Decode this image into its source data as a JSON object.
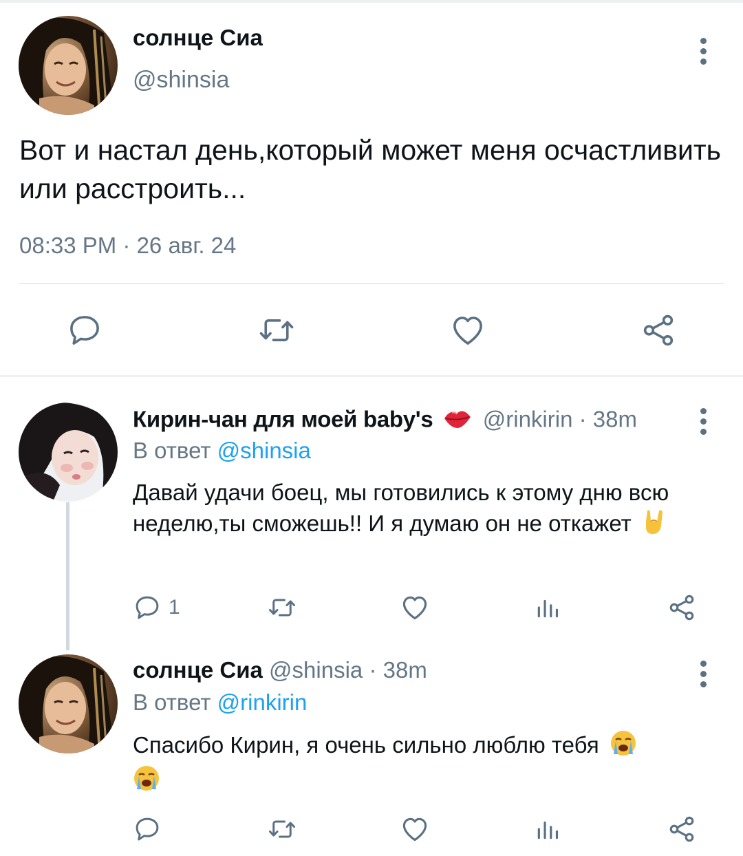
{
  "colors": {
    "accent": "#1da1f2",
    "muted": "#657786",
    "text": "#0f1419",
    "icon": "#5b7083"
  },
  "main_tweet": {
    "author_name": "солнце Сиа",
    "author_handle": "@shinsia",
    "text": "Вот и настал день,который может меня осчастливить или расстроить...",
    "timestamp": "08:33 PM · 26 авг. 24",
    "actions": [
      "reply-icon",
      "retweet-icon",
      "like-icon",
      "share-icon"
    ]
  },
  "replies": [
    {
      "author_name": "Кирин-чан для моей baby's",
      "name_emoji": "lips-emoji",
      "author_handle": "@rinkirin",
      "time": "38m",
      "separator": "·",
      "reply_prefix": "В ответ",
      "reply_to": "@shinsia",
      "text": "Давай удачи боец, мы готовились к этому дню всю неделю,ты сможешь!! И я думаю он не откажет",
      "text_emoji": "sign-of-horns-emoji",
      "reply_count": "1"
    },
    {
      "author_name": "солнце Сиа",
      "author_handle": "@shinsia",
      "time": "38m",
      "separator": "·",
      "reply_prefix": "В ответ",
      "reply_to": "@rinkirin",
      "text": "Спасибо Кирин, я очень сильно люблю тебя",
      "text_emoji": "loudly-crying-face-emoji",
      "reply_count": ""
    }
  ]
}
